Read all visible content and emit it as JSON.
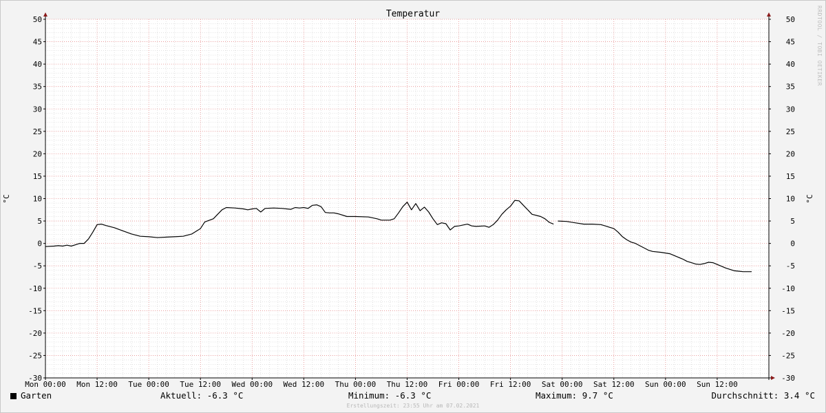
{
  "chart_data": {
    "type": "line",
    "title": "Temperatur",
    "ylabel": "°C",
    "ylabel_right": "°C",
    "ylim": [
      -30,
      50
    ],
    "y_ticks": [
      50,
      45,
      40,
      35,
      30,
      25,
      20,
      15,
      10,
      5,
      0,
      -5,
      -10,
      -15,
      -20,
      -25,
      -30
    ],
    "xlim": [
      0,
      168
    ],
    "x_ticks": [
      {
        "x": 0,
        "label": "Mon 00:00"
      },
      {
        "x": 12,
        "label": "Mon 12:00"
      },
      {
        "x": 24,
        "label": "Tue 00:00"
      },
      {
        "x": 36,
        "label": "Tue 12:00"
      },
      {
        "x": 48,
        "label": "Wed 00:00"
      },
      {
        "x": 60,
        "label": "Wed 12:00"
      },
      {
        "x": 72,
        "label": "Thu 00:00"
      },
      {
        "x": 84,
        "label": "Thu 12:00"
      },
      {
        "x": 96,
        "label": "Fri 00:00"
      },
      {
        "x": 108,
        "label": "Fri 12:00"
      },
      {
        "x": 120,
        "label": "Sat 00:00"
      },
      {
        "x": 132,
        "label": "Sat 12:00"
      },
      {
        "x": 144,
        "label": "Sun 00:00"
      },
      {
        "x": 156,
        "label": "Sun 12:00"
      }
    ],
    "grid": true,
    "series": [
      {
        "name": "Garten",
        "color": "#000000",
        "segments": [
          [
            [
              0,
              -0.7
            ],
            [
              2,
              -0.6
            ],
            [
              3,
              -0.5
            ],
            [
              4,
              -0.6
            ],
            [
              5,
              -0.4
            ],
            [
              6,
              -0.6
            ],
            [
              7,
              -0.3
            ],
            [
              8,
              0.0
            ],
            [
              9,
              0.0
            ],
            [
              10,
              1.0
            ],
            [
              11,
              2.5
            ],
            [
              12,
              4.2
            ],
            [
              13,
              4.3
            ],
            [
              14,
              4.0
            ],
            [
              16,
              3.5
            ],
            [
              18,
              2.8
            ],
            [
              20,
              2.1
            ],
            [
              22,
              1.6
            ],
            [
              24,
              1.5
            ],
            [
              26,
              1.3
            ],
            [
              28,
              1.4
            ],
            [
              30,
              1.5
            ],
            [
              32,
              1.6
            ],
            [
              34,
              2.1
            ],
            [
              36,
              3.3
            ],
            [
              37,
              4.8
            ],
            [
              39,
              5.5
            ],
            [
              40,
              6.5
            ],
            [
              41,
              7.5
            ],
            [
              42,
              8.0
            ],
            [
              44,
              7.9
            ],
            [
              46,
              7.7
            ],
            [
              47,
              7.5
            ],
            [
              48,
              7.7
            ],
            [
              49,
              7.8
            ],
            [
              50,
              7.0
            ],
            [
              51,
              7.8
            ],
            [
              53,
              7.9
            ],
            [
              55,
              7.8
            ],
            [
              57,
              7.6
            ],
            [
              58,
              8.0
            ],
            [
              59,
              7.9
            ],
            [
              60,
              8.0
            ],
            [
              61,
              7.8
            ],
            [
              62,
              8.5
            ],
            [
              63,
              8.6
            ],
            [
              64,
              8.2
            ],
            [
              65,
              6.9
            ],
            [
              66,
              6.8
            ],
            [
              67,
              6.8
            ],
            [
              68,
              6.6
            ],
            [
              70,
              6.0
            ],
            [
              72,
              6.0
            ],
            [
              75,
              5.9
            ],
            [
              77,
              5.5
            ],
            [
              78,
              5.2
            ],
            [
              80,
              5.2
            ],
            [
              81,
              5.5
            ],
            [
              82,
              6.8
            ],
            [
              83,
              8.2
            ],
            [
              84,
              9.2
            ],
            [
              85,
              7.5
            ],
            [
              86,
              8.9
            ],
            [
              87,
              7.3
            ],
            [
              88,
              8.1
            ],
            [
              89,
              7.0
            ],
            [
              90,
              5.5
            ],
            [
              91,
              4.2
            ],
            [
              92,
              4.6
            ],
            [
              93,
              4.4
            ],
            [
              94,
              3.0
            ],
            [
              95,
              3.8
            ],
            [
              96,
              3.9
            ],
            [
              98,
              4.3
            ],
            [
              99,
              3.9
            ],
            [
              100,
              3.8
            ],
            [
              102,
              3.9
            ],
            [
              103,
              3.6
            ],
            [
              104,
              4.2
            ],
            [
              105,
              5.2
            ],
            [
              106,
              6.5
            ],
            [
              107,
              7.5
            ],
            [
              108,
              8.3
            ],
            [
              109,
              9.6
            ],
            [
              110,
              9.5
            ],
            [
              111,
              8.5
            ],
            [
              112,
              7.5
            ],
            [
              113,
              6.5
            ],
            [
              115,
              6.0
            ],
            [
              116,
              5.5
            ],
            [
              117,
              4.7
            ],
            [
              118,
              4.3
            ]
          ],
          [
            [
              119,
              5.0
            ],
            [
              121,
              4.9
            ],
            [
              123,
              4.6
            ],
            [
              125,
              4.3
            ],
            [
              127,
              4.3
            ],
            [
              129,
              4.2
            ],
            [
              130,
              3.9
            ],
            [
              131,
              3.6
            ],
            [
              132,
              3.3
            ],
            [
              133,
              2.5
            ],
            [
              134,
              1.5
            ],
            [
              135,
              0.8
            ],
            [
              136,
              0.3
            ],
            [
              137,
              0.0
            ],
            [
              138,
              -0.5
            ],
            [
              139,
              -1.0
            ],
            [
              140,
              -1.5
            ],
            [
              141,
              -1.8
            ],
            [
              143,
              -2.0
            ],
            [
              145,
              -2.3
            ],
            [
              146,
              -2.7
            ],
            [
              147,
              -3.1
            ],
            [
              148,
              -3.5
            ],
            [
              149,
              -4.0
            ],
            [
              150,
              -4.3
            ],
            [
              151,
              -4.6
            ],
            [
              152,
              -4.7
            ],
            [
              153,
              -4.5
            ],
            [
              154,
              -4.2
            ],
            [
              155,
              -4.3
            ],
            [
              156,
              -4.7
            ],
            [
              157,
              -5.1
            ],
            [
              158,
              -5.5
            ],
            [
              159,
              -5.8
            ],
            [
              160,
              -6.1
            ],
            [
              161,
              -6.2
            ],
            [
              162,
              -6.3
            ],
            [
              163,
              -6.3
            ],
            [
              164,
              -6.3
            ]
          ]
        ]
      }
    ]
  },
  "legend": {
    "series_name": "Garten",
    "aktuell": "Aktuell: -6.3 °C",
    "minimum": "Minimum: -6.3 °C",
    "maximum": "Maximum: 9.7 °C",
    "durchschnitt": "Durchschnitt: 3.4 °C"
  },
  "footer": "Erstellungszeit: 23:55 Uhr am 07.02.2021",
  "watermark": "RRDTOOL / TOBI OETIKER",
  "colors": {
    "background": "#f3f3f3",
    "plot_background": "#ffffff",
    "major_grid": "#e58a8a",
    "minor_grid": "#cfcfcf",
    "axis": "#000000",
    "arrow": "#8b1a1a",
    "line": "#000000"
  }
}
